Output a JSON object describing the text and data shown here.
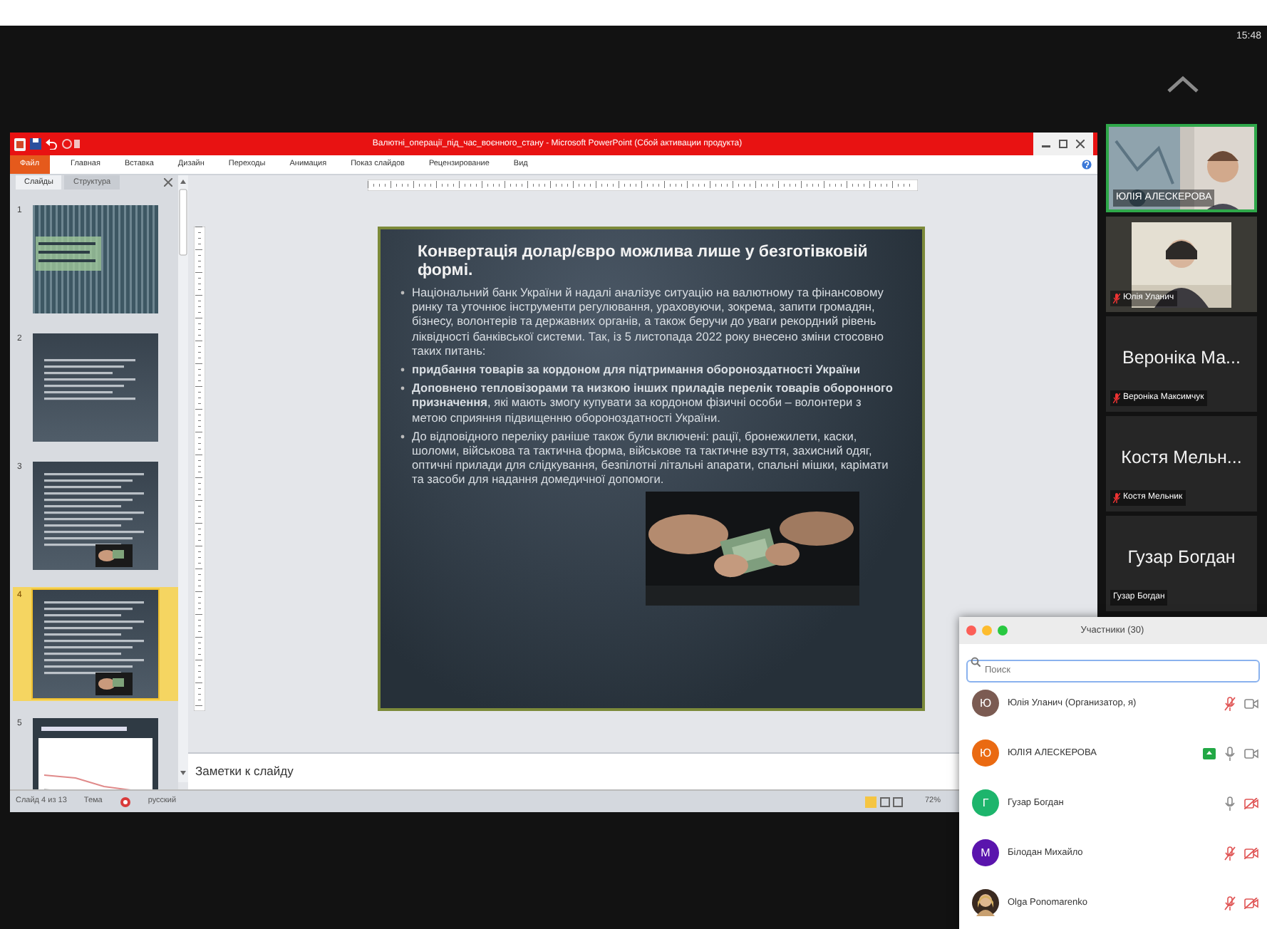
{
  "clock": "15:48",
  "powerpoint": {
    "title": "Валютні_операції_під_час_воєнного_стану - Microsoft PowerPoint (Сбой активации продукта)",
    "ribbon_tabs": [
      {
        "label": "Файл",
        "kind": "file"
      },
      {
        "label": "Главная",
        "kind": "tab"
      },
      {
        "label": "Вставка",
        "kind": "tab"
      },
      {
        "label": "Дизайн",
        "kind": "tab"
      },
      {
        "label": "Переходы",
        "kind": "tab"
      },
      {
        "label": "Анимация",
        "kind": "tab"
      },
      {
        "label": "Показ слайдов",
        "kind": "tab"
      },
      {
        "label": "Рецензирование",
        "kind": "tab"
      },
      {
        "label": "Вид",
        "kind": "tab"
      }
    ],
    "pane_tabs": [
      {
        "label": "Слайды",
        "selected": true
      },
      {
        "label": "Структура",
        "selected": false
      }
    ],
    "thumbnails": [
      {
        "number": "1",
        "kind": "title",
        "selected": false
      },
      {
        "number": "2",
        "kind": "text",
        "selected": false
      },
      {
        "number": "3",
        "selected": false
      },
      {
        "number": "4",
        "selected": true
      },
      {
        "number": "5",
        "kind": "chart",
        "selected": false
      }
    ],
    "slide": {
      "title": "Конвертація долар/євро можлива лише у безготівковій формі.",
      "bullets": [
        "Національний банк України й надалі аналізує ситуацію на валютному та фінансовому ринку та уточнює інструменти регулювання, ураховуючи, зокрема, запити громадян, бізнесу, волонтерів та державних органів, а також беручи до уваги рекордний рівень ліквідності банківської системи. Так, із 5 листопада 2022 року внесено зміни стосовно таких питань:",
        "**придбання товарів за кордоном для підтримання обороноздатності України**",
        "**Доповнено тепловізорами та низкою інших приладів перелік товарів оборонного призначення**, які мають змогу купувати за кордоном фізичні особи – волонтери з метою сприяння підвищенню обороноздатності України.",
        "До відповідного переліку раніше також були включені: рації, бронежилети, каски, шоломи, військова та тактична форма, військове та тактичне взуття, захисний одяг, оптичні прилади для слідкування, безпілотні літальні апарати, спальні мішки, карімати та засоби для надання домедичної допомоги."
      ]
    },
    "notes": {
      "placeholder": "Заметки к слайду"
    },
    "status_bar": {
      "slide": "Слайд 4 из 13",
      "theme": "Тема",
      "language": "русский",
      "zoom": "72%"
    }
  },
  "gallery": [
    {
      "kind": "video",
      "name": "ЮЛІЯ АЛЕСКЕРОВА",
      "muted": false,
      "speaking": true
    },
    {
      "kind": "video",
      "name": "Юлія Уланич",
      "muted": true,
      "speaking": false
    },
    {
      "kind": "name",
      "big_name": "Вероніка Ма...",
      "name": "Вероніка Максимчук",
      "muted": true,
      "speaking": false
    },
    {
      "kind": "name",
      "big_name": "Костя Мельн...",
      "name": "Костя Мельник",
      "muted": true,
      "speaking": false
    },
    {
      "kind": "name",
      "big_name": "Гузар Богдан",
      "name": "Гузар Богдан",
      "muted": false,
      "speaking": false
    }
  ],
  "participants": {
    "title": "Участники (30)",
    "search": {
      "placeholder": "Поиск"
    },
    "people": [
      {
        "kind": "letter",
        "initial": "Ю",
        "color": "#7b5b52",
        "name": "Юлія Уланич (Организатор, я)",
        "sharing": false,
        "muted": true,
        "video_on": true
      },
      {
        "kind": "letter",
        "initial": "Ю",
        "color": "#ea6a12",
        "name": "ЮЛІЯ АЛЕСКЕРОВА",
        "sharing": true,
        "muted": false,
        "video_on": true
      },
      {
        "kind": "letter",
        "initial": "Г",
        "color": "#1db56c",
        "name": "Гузар Богдан",
        "sharing": false,
        "muted": false,
        "video_on": false
      },
      {
        "kind": "letter",
        "initial": "М",
        "color": "#5a14ad",
        "name": "Білодан Михайло",
        "sharing": false,
        "muted": true,
        "video_on": false
      },
      {
        "name": "Olga Ponomarenko",
        "sharing": false,
        "muted": true,
        "video_on": false
      }
    ]
  }
}
